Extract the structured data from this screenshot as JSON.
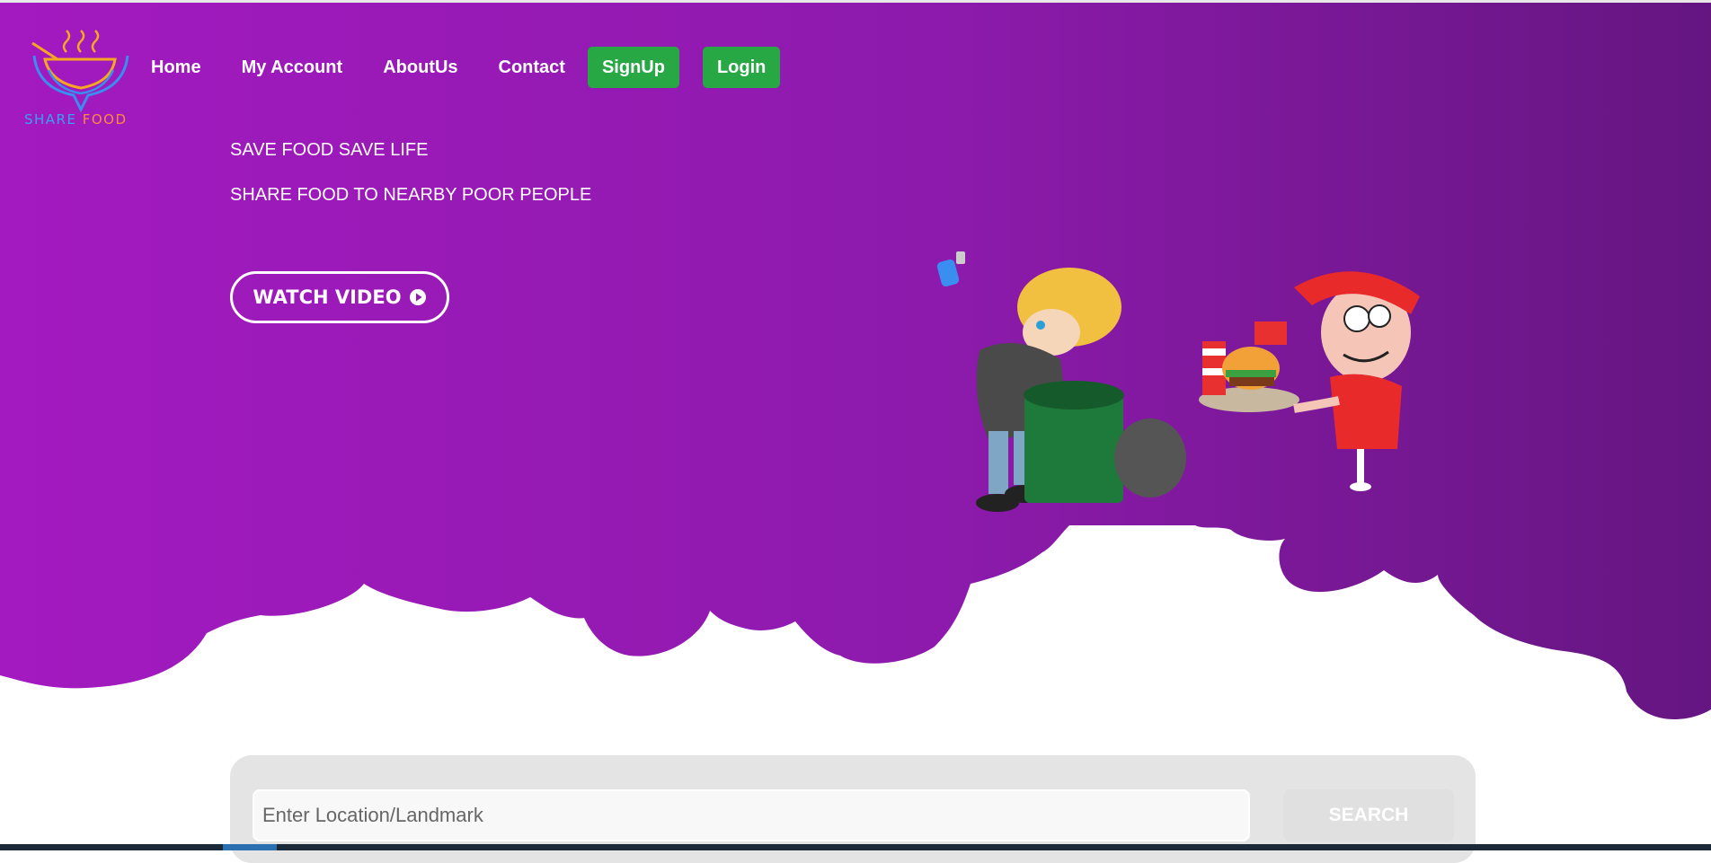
{
  "brand": {
    "logo_word1": "SHARE",
    "logo_word2": "FOOD"
  },
  "nav": {
    "links": [
      "Home",
      "My Account",
      "AboutUs",
      "Contact"
    ],
    "signup": "SignUp",
    "login": "Login"
  },
  "hero": {
    "tagline1": "SAVE FOOD SAVE LIFE",
    "tagline2": "SHARE FOOD TO NEARBY POOR PEOPLE",
    "watch_label": "WATCH VIDEO"
  },
  "search": {
    "placeholder": "Enter Location/Landmark",
    "value": "",
    "button": "SEARCH"
  },
  "colors": {
    "purple_left": "#a31ac0",
    "purple_right": "#651681",
    "button_green": "#28a745"
  },
  "icons": [
    "share-food-logo-icon",
    "play-circle-icon"
  ]
}
